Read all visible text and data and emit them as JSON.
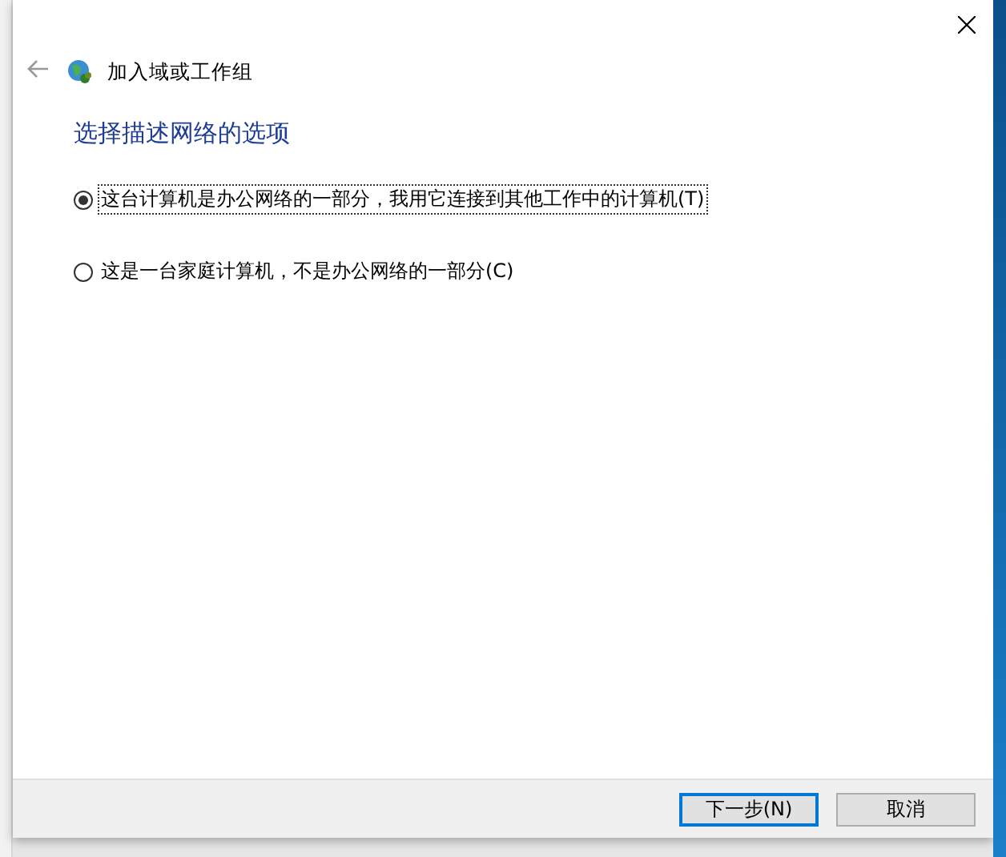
{
  "window": {
    "title": "加入域或工作组"
  },
  "heading": "选择描述网络的选项",
  "options": [
    {
      "label": "这台计算机是办公网络的一部分，我用它连接到其他工作中的计算机(T)",
      "selected": true
    },
    {
      "label": "这是一台家庭计算机，不是办公网络的一部分(C)",
      "selected": false
    }
  ],
  "buttons": [
    {
      "label": "下一步(N)",
      "kind": "default"
    },
    {
      "label": "取消",
      "kind": "normal"
    }
  ]
}
